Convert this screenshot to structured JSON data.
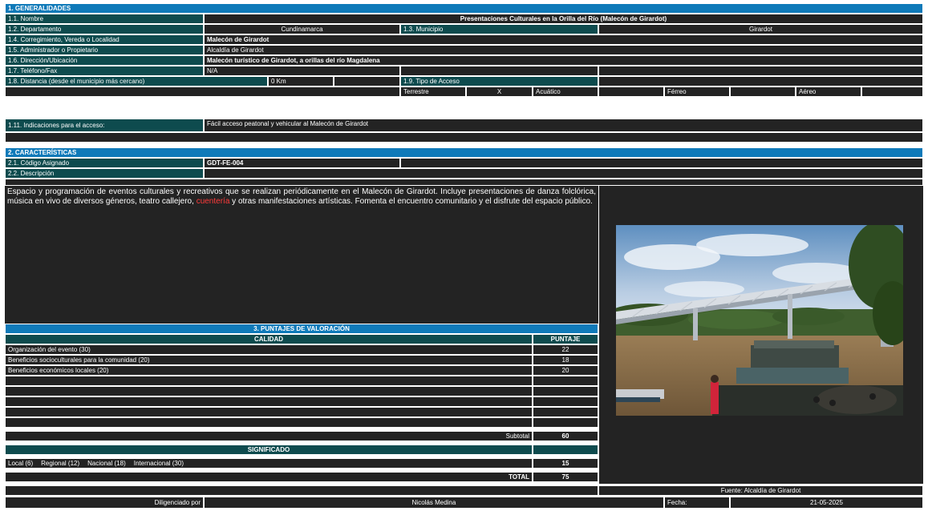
{
  "sections": {
    "generalidades": "1. GENERALIDADES",
    "caracteristicas": "2. CARACTERÍSTICAS",
    "puntajes": "3. PUNTAJES DE VALORACIÓN"
  },
  "general": {
    "nombre_label": "1.1. Nombre",
    "nombre_value": "Presentaciones Culturales en la Orilla del Río (Malecón de Girardot)",
    "departamento_label": "1.2. Departamento",
    "departamento_value": "Cundinamarca",
    "municipio_label": "1.3. Municipio",
    "municipio_value": "Girardot",
    "corregimiento_label": "1.4. Corregimiento, Vereda o Localidad",
    "corregimiento_value": "Malecón de Girardot",
    "administrador_label": "1.5. Administrador o Propietario",
    "administrador_value": "Alcaldía de Girardot",
    "direccion_label": "1.6. Dirección/Ubicación",
    "direccion_value": "Malecón turístico de Girardot, a orillas del río Magdalena",
    "telefono_label": "1.7. Teléfono/Fax",
    "telefono_value": "N/A",
    "distancia_label": "1.8. Distancia (desde el municipio más cercano)",
    "distancia_value": "0 Km",
    "tipo_acceso_label": "1.9. Tipo de Acceso",
    "acceso_terrestre": "Terrestre",
    "acceso_terrestre_mark": "X",
    "acceso_acuatico": "Acuático",
    "acceso_ferreo": "Férreo",
    "acceso_aereo": "Aéreo",
    "indicaciones_label": "1.11. Indicaciones para el acceso:",
    "indicaciones_value": "Fácil acceso peatonal y vehicular al Malecón de Girardot"
  },
  "caracteristicas": {
    "codigo_label": "2.1. Código Asignado",
    "codigo_value": "GDT-FE-004",
    "descripcion_label": "2.2. Descripción",
    "descripcion_part1": "Espacio y programación de eventos culturales y recreativos que se realizan periódicamente en el Malecón de Girardot. Incluye presentaciones de danza folclórica, música en vivo de diversos géneros, teatro callejero, ",
    "descripcion_highlight": "cuentería",
    "descripcion_part2": " y otras manifestaciones artísticas. Fomenta el encuentro comunitario y el disfrute del espacio público."
  },
  "puntajes": {
    "calidad_header": "CALIDAD",
    "puntaje_header": "PUNTAJE",
    "criterios": [
      {
        "label": "Organización del evento (30)",
        "score": "22"
      },
      {
        "label": "Beneficios socioculturales para la comunidad (20)",
        "score": "18"
      },
      {
        "label": "Beneficios económicos locales (20)",
        "score": "20"
      }
    ],
    "subtotal_label": "Subtotal",
    "subtotal_value": "60",
    "significado_header": "SIGNIFICADO",
    "significado_local": "Local (6)",
    "significado_regional": "Regional (12)",
    "significado_nacional": "Nacional (18)",
    "significado_internacional": "Internacional (30)",
    "significado_value": "15",
    "total_label": "TOTAL",
    "total_value": "75"
  },
  "footer": {
    "fuente": "Fuente: Alcaldía de Girardot",
    "diligenciado_label": "Diligenciado por",
    "diligenciado_value": "Nicolás Medina",
    "fecha_label": "Fecha:",
    "fecha_value": "21-05-2025"
  },
  "colors": {
    "header_blue": "#0f7ab9",
    "label_teal": "#0e4b4e",
    "cell_dark": "#232323"
  }
}
